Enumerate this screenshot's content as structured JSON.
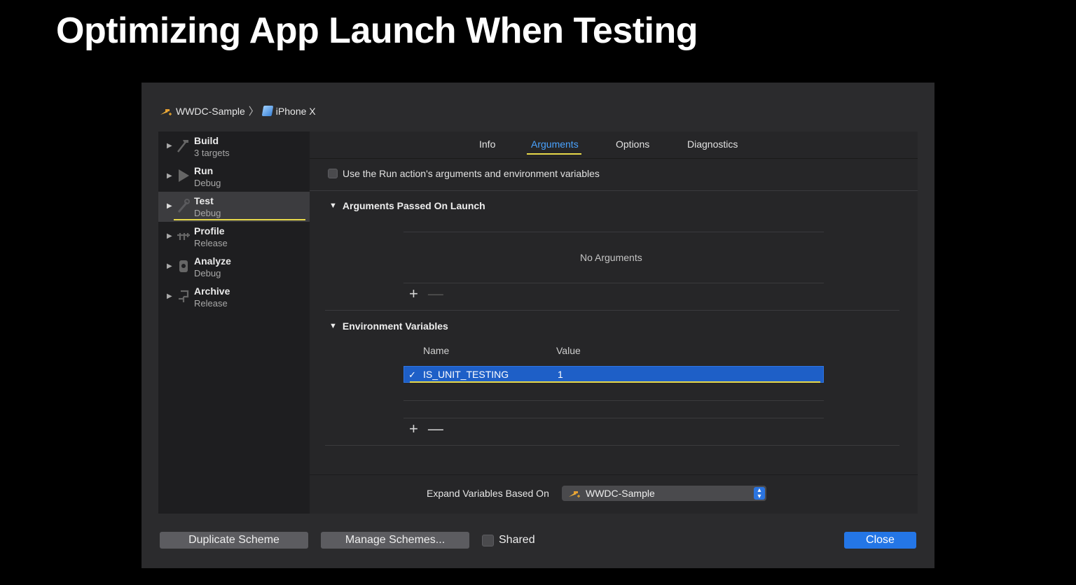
{
  "slide": {
    "title": "Optimizing App Launch When Testing"
  },
  "breadcrumb": {
    "scheme": "WWDC-Sample",
    "separator": "〉",
    "device": "iPhone X"
  },
  "sidebar": {
    "items": [
      {
        "title": "Build",
        "sub": "3 targets",
        "icon": "hammer-icon"
      },
      {
        "title": "Run",
        "sub": "Debug",
        "icon": "play-icon"
      },
      {
        "title": "Test",
        "sub": "Debug",
        "icon": "wrench-icon",
        "selected": true
      },
      {
        "title": "Profile",
        "sub": "Release",
        "icon": "gauge-icon"
      },
      {
        "title": "Analyze",
        "sub": "Debug",
        "icon": "analyze-icon"
      },
      {
        "title": "Archive",
        "sub": "Release",
        "icon": "archive-icon"
      }
    ]
  },
  "tabs": [
    "Info",
    "Arguments",
    "Options",
    "Diagnostics"
  ],
  "active_tab": "Arguments",
  "use_run_label": "Use the Run action's arguments and environment variables",
  "arguments": {
    "header": "Arguments Passed On Launch",
    "empty_text": "No Arguments",
    "plus": "+",
    "minus": "—"
  },
  "environment": {
    "header": "Environment Variables",
    "col_name": "Name",
    "col_value": "Value",
    "rows": [
      {
        "checked": "✓",
        "name": "IS_UNIT_TESTING",
        "value": "1"
      }
    ],
    "plus": "+",
    "minus": "—"
  },
  "expand": {
    "label": "Expand Variables Based On",
    "value": "WWDC-Sample"
  },
  "footer": {
    "duplicate": "Duplicate Scheme",
    "manage": "Manage Schemes...",
    "shared": "Shared",
    "close": "Close"
  },
  "colors": {
    "accent": "#4aa3ff",
    "highlight": "#e7d94a",
    "selection": "#1e5fc7",
    "button_blue": "#2476e6"
  }
}
